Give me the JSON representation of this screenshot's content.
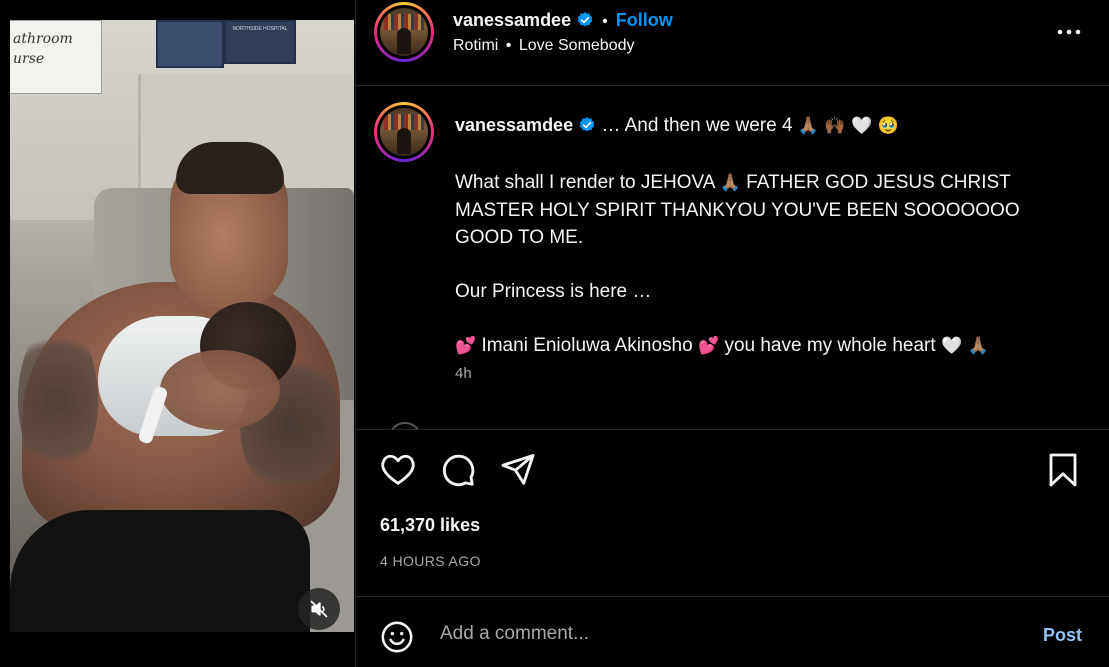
{
  "media": {
    "sign_text_line1": "athroom",
    "sign_text_line2": "urse",
    "plaque_text": "NORTHSIDE HOSPITAL",
    "mute_icon": "speaker-muted-icon"
  },
  "post": {
    "author": {
      "username": "vanessamdee",
      "verified": true,
      "avatar_icon": "profile-avatar"
    },
    "header": {
      "follow_label": "Follow",
      "separator": "•",
      "audio_artist": "Rotimi",
      "audio_separator": "•",
      "audio_title": "Love Somebody",
      "more_icon": "more-options-icon"
    },
    "caption": {
      "line1_text": "… And then we were 4",
      "line1_emoji": "🙏🏽 🙌🏾 🤍 🥹",
      "para2_text": "What shall I render to JEHOVA",
      "para2_emoji": "🙏🏽",
      "para2_rest": "FATHER GOD JESUS CHRIST MASTER HOLY SPIRIT THANKYOU YOU'VE BEEN SOOOOOOO GOOD TO ME.",
      "para3": "Our Princess is here …",
      "para4_emoji_start": "💕",
      "para4_name": "Imani Enioluwa Akinosho",
      "para4_emoji_mid": "💕",
      "para4_text": "you have my whole heart",
      "para4_emoji_end": "🤍 🙏🏽",
      "time_ago": "4h"
    },
    "actions": {
      "like_icon": "heart-icon",
      "comment_icon": "comment-icon",
      "share_icon": "share-icon",
      "save_icon": "bookmark-icon"
    },
    "likes": "61,370 likes",
    "timestamp": "4 HOURS AGO",
    "comment_box": {
      "emoji_icon": "smiley-icon",
      "placeholder": "Add a comment...",
      "post_label": "Post"
    }
  },
  "colors": {
    "background": "#000000",
    "text": "#f5f5f5",
    "secondary_text": "#a8a8a8",
    "accent_blue": "#0095f6",
    "divider": "#262626"
  }
}
